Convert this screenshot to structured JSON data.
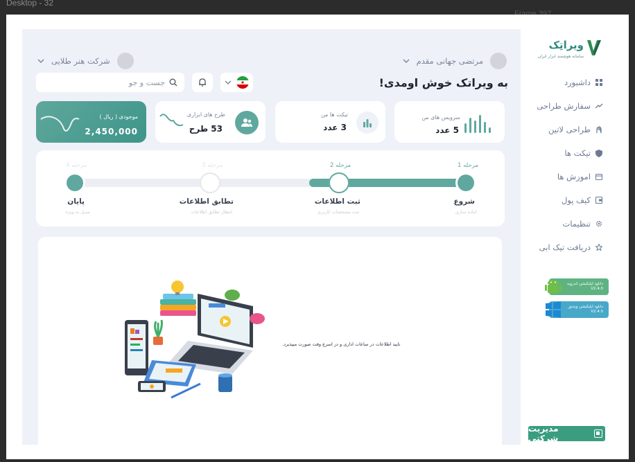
{
  "frame": {
    "title": "Desktop - 32",
    "label2": "Frame 397"
  },
  "logo": {
    "title": "ویراتِک",
    "subtitle": "سامانه هوشمند ابزار ایران"
  },
  "sidebar": {
    "items": [
      {
        "label": "داشبورد",
        "icon": "grid-icon"
      },
      {
        "label": "سفارش طراحی",
        "icon": "trend-icon"
      },
      {
        "label": "طراحی لاتین",
        "icon": "hand-icon"
      },
      {
        "label": "تیکت ها",
        "icon": "shield-icon"
      },
      {
        "label": "اموزش ها",
        "icon": "calendar-icon"
      },
      {
        "label": "کیف پول",
        "icon": "wallet-icon"
      },
      {
        "label": "تنظیمات",
        "icon": "gear-icon"
      },
      {
        "label": "دریافت تیک ابی",
        "icon": "star-icon"
      }
    ],
    "android": {
      "line1": "دانلود اپلیکیشن اندروید",
      "version": "V2.4.0"
    },
    "windows": {
      "line1": "دانلود اپلیکیشن ویندوز",
      "version": "V2.4.0"
    },
    "corporate": "مدیریت شرکتی"
  },
  "header": {
    "user_name": "مرتضی جهانی مقدم",
    "company_name": "شرکت هنر طلایی",
    "welcome": "به ویراتک خوش اومدی!",
    "search_placeholder": "جست و جو"
  },
  "cards": {
    "services": {
      "title": "سرویس های من",
      "value": "5 عدد"
    },
    "tickets": {
      "title": "تیکت ها من",
      "value": "3 عدد"
    },
    "designs": {
      "title": "طرح های ابزاری",
      "value": "53 طرح"
    },
    "balance": {
      "title": "موجودی ( ریال )",
      "value": "2,450,000"
    }
  },
  "steps": [
    {
      "num": "مرحله 1",
      "name": "شروع",
      "desc": "اماده سازی",
      "state": "done"
    },
    {
      "num": "مرحله 2",
      "name": "ثبت اطلاعات",
      "desc": "ثبت مشخصات کاربری",
      "state": "current"
    },
    {
      "num": "مرحله 3",
      "name": "تطابق اطلاعات",
      "desc": "انتظار تطابق اطلاعات",
      "state": "pending"
    },
    {
      "num": "مرحله 4",
      "name": "پایان",
      "desc": "تبدیل به ویژه",
      "state": "end"
    }
  ],
  "progress": 0.4,
  "panel": {
    "message": "تایید اطلاعات در ساعات اداری و در اسرع وقت صورت میپذیرد."
  },
  "colors": {
    "accent": "#5fa89f",
    "accent_dark": "#3e958a",
    "text_muted": "#7b8598",
    "android": "#5fb383",
    "windows": "#48a8c8"
  }
}
